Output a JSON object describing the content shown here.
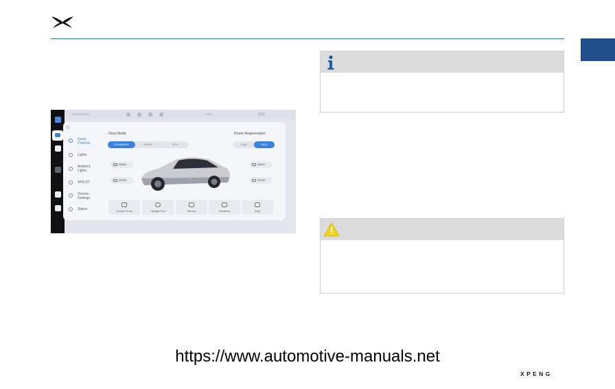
{
  "document": {
    "footer_url": "https://www.automotive-manuals.net",
    "brand_wordmark": "XPENG",
    "logo_icon": "xpeng-logo-icon"
  },
  "colors": {
    "header_rule": "#2e6f86",
    "side_tab": "#1f4e8a",
    "info_icon": "#1f5fa8",
    "warning_icon": "#f2d21b",
    "notice_header": "#dcdcdc",
    "accent_blue": "#3b82e0"
  },
  "notices": {
    "info": {
      "icon": "info-icon"
    },
    "warning": {
      "icon": "warning-triangle-icon"
    }
  },
  "figure": {
    "menu": [
      {
        "label": "Quick\nControls",
        "active": true
      },
      {
        "label": "Lights",
        "active": false
      },
      {
        "label": "Ambient\nLights",
        "active": false
      },
      {
        "label": "XPILOT",
        "active": false
      },
      {
        "label": "Vehicle\nSettings",
        "active": false
      },
      {
        "label": "Status",
        "active": false
      }
    ],
    "drive_mode": {
      "label": "Drive Mode",
      "options": [
        "STANDARD",
        "SPORT",
        "ECO"
      ],
      "selected": "STANDARD"
    },
    "power_regeneration": {
      "label": "Power Regeneration",
      "options": [
        "LOW",
        "HIGH"
      ],
      "selected": "HIGH"
    },
    "side_buttons": {
      "left_top": "Open",
      "left_bottom": "Close",
      "right_top": "Open",
      "right_bottom": "Close"
    },
    "tiles": [
      "Unlock Trunk",
      "Charge Port",
      "Mirrors",
      "Windows",
      "Seat"
    ]
  }
}
